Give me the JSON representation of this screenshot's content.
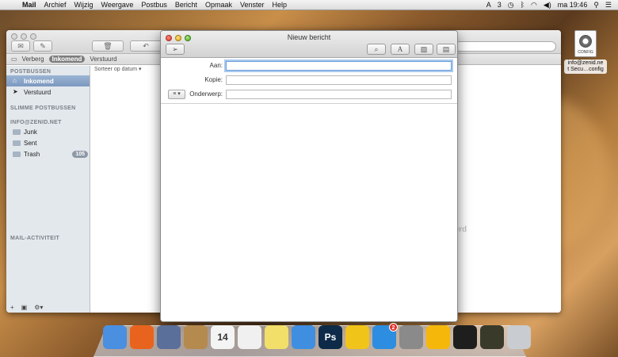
{
  "menubar": {
    "app_name": "Mail",
    "items": [
      "Archief",
      "Wijzig",
      "Weergave",
      "Postbus",
      "Bericht",
      "Opmaak",
      "Venster",
      "Help"
    ],
    "status_count": "3",
    "clock": "ma 19:46"
  },
  "mail_window": {
    "favorites": {
      "hide_label": "Verberg",
      "inbox_label": "Inkomend",
      "sent_label": "Verstuurd"
    },
    "sidebar": {
      "mailboxes_header": "POSTBUSSEN",
      "mailboxes": [
        {
          "label": "Inkomend"
        },
        {
          "label": "Verstuurd"
        }
      ],
      "smart_header": "SLIMME POSTBUSSEN",
      "account_header": "INFO@ZENID.NET",
      "folders": [
        {
          "label": "Junk"
        },
        {
          "label": "Sent"
        },
        {
          "label": "Trash",
          "badge": "105"
        }
      ],
      "activity_header": "MAIL-ACTIVITEIT"
    },
    "sort_label": "Sorteer op datum ▾",
    "faded_text": "eerd"
  },
  "compose_window": {
    "title": "Nieuw bericht",
    "fields": {
      "to_label": "Aan:",
      "to_value": "",
      "cc_label": "Kopie:",
      "cc_value": "",
      "subject_label": "Onderwerp:",
      "subject_value": ""
    }
  },
  "desktop_icon": {
    "doc_tag": "CONFIG",
    "label": "info@zenid.ne\nt Secu…config"
  },
  "dock": {
    "items": [
      {
        "name": "finder-icon",
        "color": "#4a8fe0"
      },
      {
        "name": "firefox-icon",
        "color": "#e8641e"
      },
      {
        "name": "launchpad-icon",
        "color": "#5a6f9a"
      },
      {
        "name": "contacts-icon",
        "color": "#b58a4e"
      },
      {
        "name": "calendar-icon",
        "color": "#f4f4f4",
        "text": "14"
      },
      {
        "name": "reminders-icon",
        "color": "#f0f0f0"
      },
      {
        "name": "notes-icon",
        "color": "#f1df6a"
      },
      {
        "name": "itunes-icon",
        "color": "#3f8ee0"
      },
      {
        "name": "photoshop-icon",
        "color": "#0d2a48",
        "text": "Ps"
      },
      {
        "name": "cyberduck-icon",
        "color": "#f0c419"
      },
      {
        "name": "app-store-icon",
        "color": "#2d8de0",
        "badge": "2"
      },
      {
        "name": "system-preferences-icon",
        "color": "#8a8a8a"
      },
      {
        "name": "opera-icon",
        "color": "#f5b80a"
      },
      {
        "name": "terminal-icon",
        "color": "#1e1e1e"
      },
      {
        "name": "radar-icon",
        "color": "#3a3a2a"
      },
      {
        "name": "trash-icon",
        "color": "#c9ccd0"
      }
    ]
  }
}
